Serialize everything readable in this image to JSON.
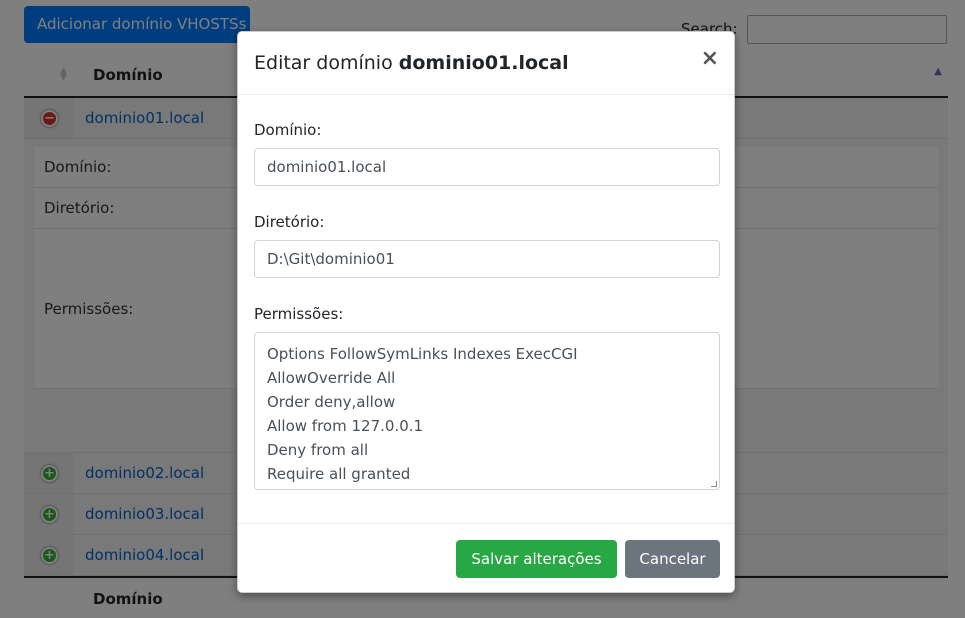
{
  "background": {
    "add_button_label": "Adicionar domínio VHOSTSs",
    "search_label": "Search:",
    "search_value": "",
    "table": {
      "header_domain": "Domínio",
      "footer_domain": "Domínio",
      "rows": [
        {
          "domain": "dominio01.local",
          "expanded": true
        },
        {
          "domain": "dominio02.local",
          "expanded": false
        },
        {
          "domain": "dominio03.local",
          "expanded": false
        },
        {
          "domain": "dominio04.local",
          "expanded": false
        }
      ],
      "detail_labels": {
        "domain": "Domínio:",
        "directory": "Diretório:",
        "permissions": "Permissões:"
      }
    }
  },
  "modal": {
    "title_prefix": "Editar domínio",
    "title_domain": "dominio01.local",
    "close_symbol": "×",
    "fields": {
      "domain_label": "Domínio:",
      "domain_value": "dominio01.local",
      "directory_label": "Diretório:",
      "directory_value": "D:\\Git\\dominio01",
      "permissions_label": "Permissões:",
      "permissions_lines": [
        "Options FollowSymLinks Indexes ExecCGI",
        "AllowOverride All",
        "Order deny,allow",
        "Allow from 127.0.0.1",
        "Deny from all",
        "Require all granted"
      ]
    },
    "save_label": "Salvar alterações",
    "cancel_label": "Cancelar"
  },
  "colors": {
    "primary": "#007bff",
    "success": "#28a745",
    "secondary": "#6c757d",
    "link": "#0062cc"
  }
}
